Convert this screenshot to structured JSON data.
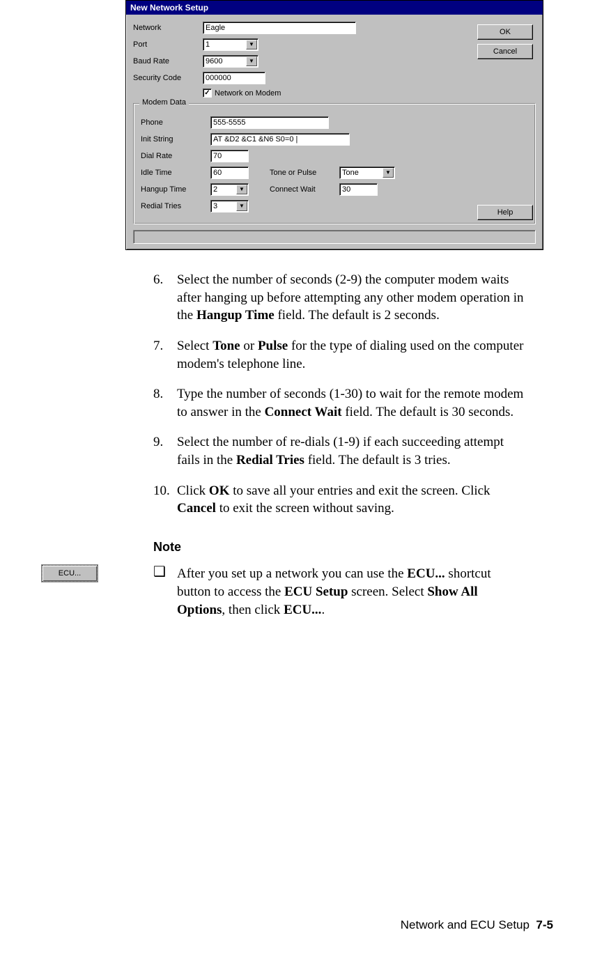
{
  "dialog": {
    "title": "New Network Setup",
    "ok": "OK",
    "cancel": "Cancel",
    "help": "Help",
    "fields": {
      "network_label": "Network",
      "network_value": "Eagle",
      "port_label": "Port",
      "port_value": "1",
      "baud_label": "Baud Rate",
      "baud_value": "9600",
      "security_label": "Security Code",
      "security_value": "000000",
      "modem_checkbox_label": "Network on Modem",
      "modem_checkbox_checked": "✓"
    },
    "modem": {
      "legend": "Modem Data",
      "phone_label": "Phone",
      "phone_value": "555-5555",
      "init_label": "Init String",
      "init_value": "AT &D2 &C1 &N6 S0=0 |",
      "dialrate_label": "Dial Rate",
      "dialrate_value": "70",
      "idle_label": "Idle Time",
      "idle_value": "60",
      "tone_label": "Tone or Pulse",
      "tone_value": "Tone",
      "hangup_label": "Hangup Time",
      "hangup_value": "2",
      "connect_label": "Connect Wait",
      "connect_value": "30",
      "redial_label": "Redial Tries",
      "redial_value": "3"
    }
  },
  "steps": {
    "s6_num": "6.",
    "s6_a": "Select the number of seconds (2-9) the computer modem waits after hanging up before attempting any other modem operation in the ",
    "s6_b": "Hangup Time",
    "s6_c": " field. The default is 2 seconds.",
    "s7_num": "7.",
    "s7_a": "Select ",
    "s7_b": "Tone",
    "s7_c": " or ",
    "s7_d": "Pulse",
    "s7_e": " for the type of dialing used on the computer modem's telephone line.",
    "s8_num": "8.",
    "s8_a": "Type the number of seconds (1-30) to wait for the remote modem to answer in the ",
    "s8_b": "Connect Wait",
    "s8_c": " field. The default is 30 seconds.",
    "s9_num": "9.",
    "s9_a": "Select the number of re-dials (1-9) if each succeeding attempt fails in the ",
    "s9_b": "Redial Tries",
    "s9_c": " field. The default is 3 tries.",
    "s10_num": "10.",
    "s10_a": "Click ",
    "s10_b": "OK",
    "s10_c": " to save all your entries and exit the screen. Click ",
    "s10_d": "Cancel",
    "s10_e": " to exit the screen without saving."
  },
  "note": {
    "heading": "Note",
    "bullet": "❑",
    "a": "After you set up a network you can use the ",
    "b": "ECU...",
    "c": " shortcut button to access the ",
    "d": "ECU Setup",
    "e": " screen. Select ",
    "f": "Show All Options",
    "g": ", then click ",
    "h": "ECU...",
    "i": "."
  },
  "ecu_btn_label": "ECU...",
  "footer": {
    "title": "Network and ECU Setup",
    "page": "7-5"
  }
}
